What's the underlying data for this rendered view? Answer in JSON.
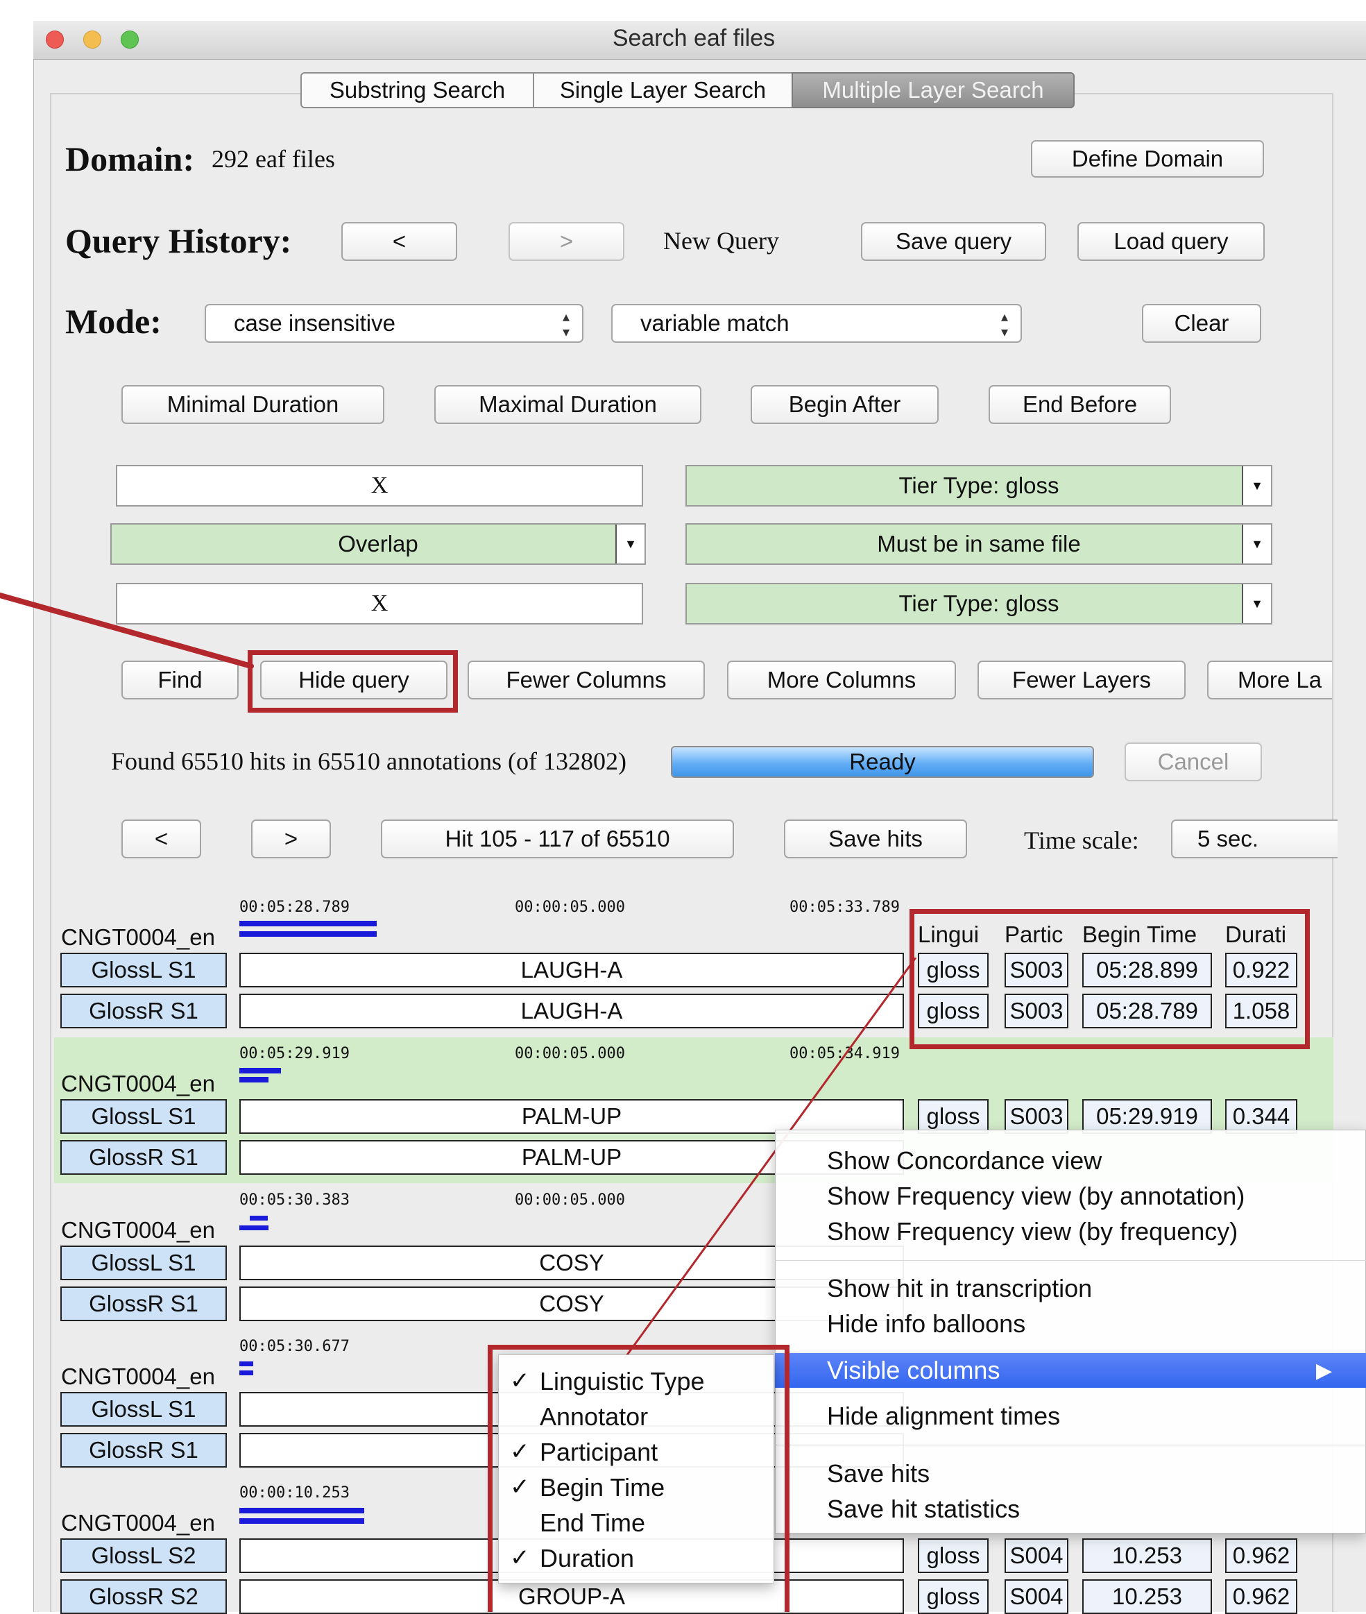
{
  "window": {
    "title": "Search eaf files"
  },
  "tabs": [
    "Substring Search",
    "Single Layer Search",
    "Multiple Layer Search"
  ],
  "domain": {
    "label": "Domain:",
    "value": "292 eaf files",
    "button": "Define Domain"
  },
  "query_history": {
    "label": "Query History:",
    "prev": "<",
    "next": ">",
    "current": "New Query",
    "save": "Save query",
    "load": "Load query"
  },
  "mode": {
    "label": "Mode:",
    "case": "case insensitive",
    "match": "variable match",
    "clear": "Clear"
  },
  "constraints": {
    "min_duration": "Minimal Duration",
    "max_duration": "Maximal Duration",
    "begin_after": "Begin After",
    "end_before": "End Before"
  },
  "query_rows": {
    "field1": "X",
    "tier1": "Tier Type: gloss",
    "relation": "Overlap",
    "scope": "Must be in same file",
    "field2": "X",
    "tier2": "Tier Type: gloss"
  },
  "actions": {
    "find": "Find",
    "hide_query": "Hide query",
    "fewer_columns": "Fewer Columns",
    "more_columns": "More Columns",
    "fewer_layers": "Fewer Layers",
    "more_layers": "More La"
  },
  "status": {
    "found": "Found 65510 hits in 65510 annotations (of 132802)",
    "progress": "Ready",
    "progress_value": 1.0,
    "cancel": "Cancel"
  },
  "nav": {
    "prev": "<",
    "next": ">",
    "range": "Hit 105 - 117 of 65510",
    "save_hits": "Save hits",
    "timescale_label": "Time scale:",
    "timescale": "5 sec."
  },
  "columns": [
    "Lingui",
    "Partic",
    "Begin Time",
    "Durati"
  ],
  "hits": [
    {
      "file": "CNGT0004_en",
      "t_start": "00:05:28.789",
      "t_mid": "00:00:05.000",
      "t_end": "00:05:33.789",
      "rows": [
        {
          "tier": "GlossL S1",
          "anno": "LAUGH-A",
          "ling": "gloss",
          "part": "S003",
          "begin": "05:28.899",
          "dur": "0.922"
        },
        {
          "tier": "GlossR S1",
          "anno": "LAUGH-A",
          "ling": "gloss",
          "part": "S003",
          "begin": "05:28.789",
          "dur": "1.058"
        }
      ]
    },
    {
      "file": "CNGT0004_en",
      "t_start": "00:05:29.919",
      "t_mid": "00:00:05.000",
      "t_end": "00:05:34.919",
      "rows": [
        {
          "tier": "GlossL S1",
          "anno": "PALM-UP",
          "ling": "gloss",
          "part": "S003",
          "begin": "05:29.919",
          "dur": "0.344"
        },
        {
          "tier": "GlossR S1",
          "anno": "PALM-UP",
          "ling": "",
          "part": "",
          "begin": "",
          "dur": ""
        }
      ]
    },
    {
      "file": "CNGT0004_en",
      "t_start": "00:05:30.383",
      "t_mid": "00:00:05.000",
      "t_end": "",
      "rows": [
        {
          "tier": "GlossL S1",
          "anno": "COSY",
          "ling": "",
          "part": "",
          "begin": "",
          "dur": ""
        },
        {
          "tier": "GlossR S1",
          "anno": "COSY",
          "ling": "",
          "part": "",
          "begin": "",
          "dur": ""
        }
      ]
    },
    {
      "file": "CNGT0004_en",
      "t_start": "00:05:30.677",
      "t_mid": "",
      "t_end": "",
      "rows": [
        {
          "tier": "GlossL S1",
          "anno": "",
          "ling": "",
          "part": "",
          "begin": "",
          "dur": ""
        },
        {
          "tier": "GlossR S1",
          "anno": "",
          "ling": "",
          "part": "",
          "begin": "",
          "dur": ""
        }
      ]
    },
    {
      "file": "CNGT0004_en",
      "t_start": "00:00:10.253",
      "t_mid": "",
      "t_end": "",
      "rows": [
        {
          "tier": "GlossL S2",
          "anno": "",
          "ling": "gloss",
          "part": "S004",
          "begin": "10.253",
          "dur": "0.962"
        },
        {
          "tier": "GlossR S2",
          "anno": "GROUP-A",
          "ling": "gloss",
          "part": "S004",
          "begin": "10.253",
          "dur": "0.962"
        }
      ]
    }
  ],
  "context_menu": {
    "items": [
      "Show Concordance view",
      "Show Frequency view (by annotation)",
      "Show Frequency view (by frequency)",
      "Show hit in transcription",
      "Hide info balloons",
      "Visible columns",
      "Hide alignment times",
      "Save hits",
      "Save hit statistics"
    ],
    "submenu_arrow": "▶"
  },
  "submenu": {
    "items": [
      {
        "label": "Linguistic Type",
        "checked": true
      },
      {
        "label": "Annotator",
        "checked": false
      },
      {
        "label": "Participant",
        "checked": true
      },
      {
        "label": "Begin Time",
        "checked": true
      },
      {
        "label": "End Time",
        "checked": false
      },
      {
        "label": "Duration",
        "checked": true
      }
    ],
    "check": "✓"
  },
  "colors": {
    "accent_red": "#b3282d",
    "menu_highlight": "#3d6ef2",
    "tier_blue": "#cde2f7",
    "selected_green": "#cfe8c8",
    "bar_blue": "#1a1adb"
  }
}
